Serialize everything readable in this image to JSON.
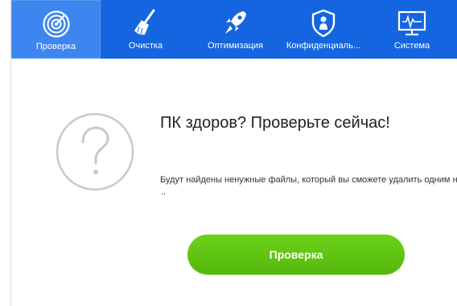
{
  "toolbar": {
    "tabs": [
      {
        "label": "Проверка",
        "icon": "radar-icon",
        "active": true
      },
      {
        "label": "Очистка",
        "icon": "broom-icon",
        "active": false
      },
      {
        "label": "Оптимизация",
        "icon": "rocket-icon",
        "active": false
      },
      {
        "label": "Конфиденциаль...",
        "icon": "shield-icon",
        "active": false
      },
      {
        "label": "Система",
        "icon": "monitor-icon",
        "active": false
      }
    ]
  },
  "main": {
    "status_icon": "question-icon",
    "headline": "ПК здоров? Проверьте сейчас!",
    "description": "Будут найдены ненужные файлы, который вы сможете удалить одним н",
    "description_more": "..",
    "scan_button": "Проверка"
  },
  "colors": {
    "toolbar": "#1565e0",
    "active_tab": "#3d86f0",
    "button_green": "#5cc212"
  }
}
